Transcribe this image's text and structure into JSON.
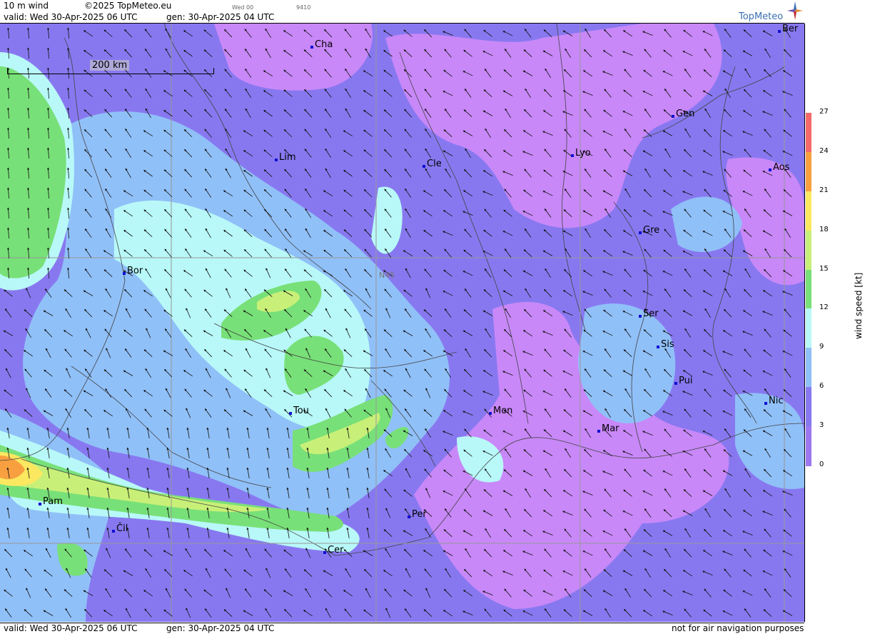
{
  "header": {
    "product": "10 m wind",
    "copyright": "©2025 TopMeteo.eu",
    "valid": "valid:  Wed  30-Apr-2025  06 UTC",
    "gen": "gen: 30-Apr-2025 04 UTC",
    "frame": "Wed 00",
    "code": "9410"
  },
  "logo": {
    "text": "TopMeteo",
    "icon": "compass-star-icon"
  },
  "map": {
    "scale_label": "200 km",
    "gridline_label": "N45",
    "cities": [
      {
        "id": "cha",
        "name": "Cha"
      },
      {
        "id": "ber",
        "name": "Ber"
      },
      {
        "id": "gen",
        "name": "Gen"
      },
      {
        "id": "lim",
        "name": "Lim"
      },
      {
        "id": "cle",
        "name": "Cle"
      },
      {
        "id": "lyo",
        "name": "Lyo"
      },
      {
        "id": "aos",
        "name": "Aos"
      },
      {
        "id": "gre",
        "name": "Gre"
      },
      {
        "id": "bor",
        "name": "Bor"
      },
      {
        "id": "ser",
        "name": "Ser"
      },
      {
        "id": "sis",
        "name": "Sis"
      },
      {
        "id": "pui",
        "name": "Pui"
      },
      {
        "id": "tou",
        "name": "Tou"
      },
      {
        "id": "mon",
        "name": "Mon"
      },
      {
        "id": "nic",
        "name": "Nic"
      },
      {
        "id": "mar",
        "name": "Mar"
      },
      {
        "id": "pam",
        "name": "Pam"
      },
      {
        "id": "cil",
        "name": "Čil"
      },
      {
        "id": "per",
        "name": "Per"
      },
      {
        "id": "cer",
        "name": "Cer"
      }
    ]
  },
  "colorbar": {
    "title": "wind  speed  [kt]",
    "ticks": [
      "27",
      "24",
      "21",
      "18",
      "15",
      "12",
      "9",
      "6",
      "3",
      "0"
    ],
    "colors": [
      "#f46a6a",
      "#f8a040",
      "#fbe860",
      "#c8f078",
      "#78e078",
      "#b8f8f8",
      "#90c0f8",
      "#8878f0",
      "#9c78f0",
      "#c888f8"
    ]
  },
  "footer": {
    "valid": "valid:  Wed  30-Apr-2025  06 UTC",
    "gen": "gen: 30-Apr-2025 04 UTC",
    "disclaimer": "not for air navigation purposes"
  }
}
